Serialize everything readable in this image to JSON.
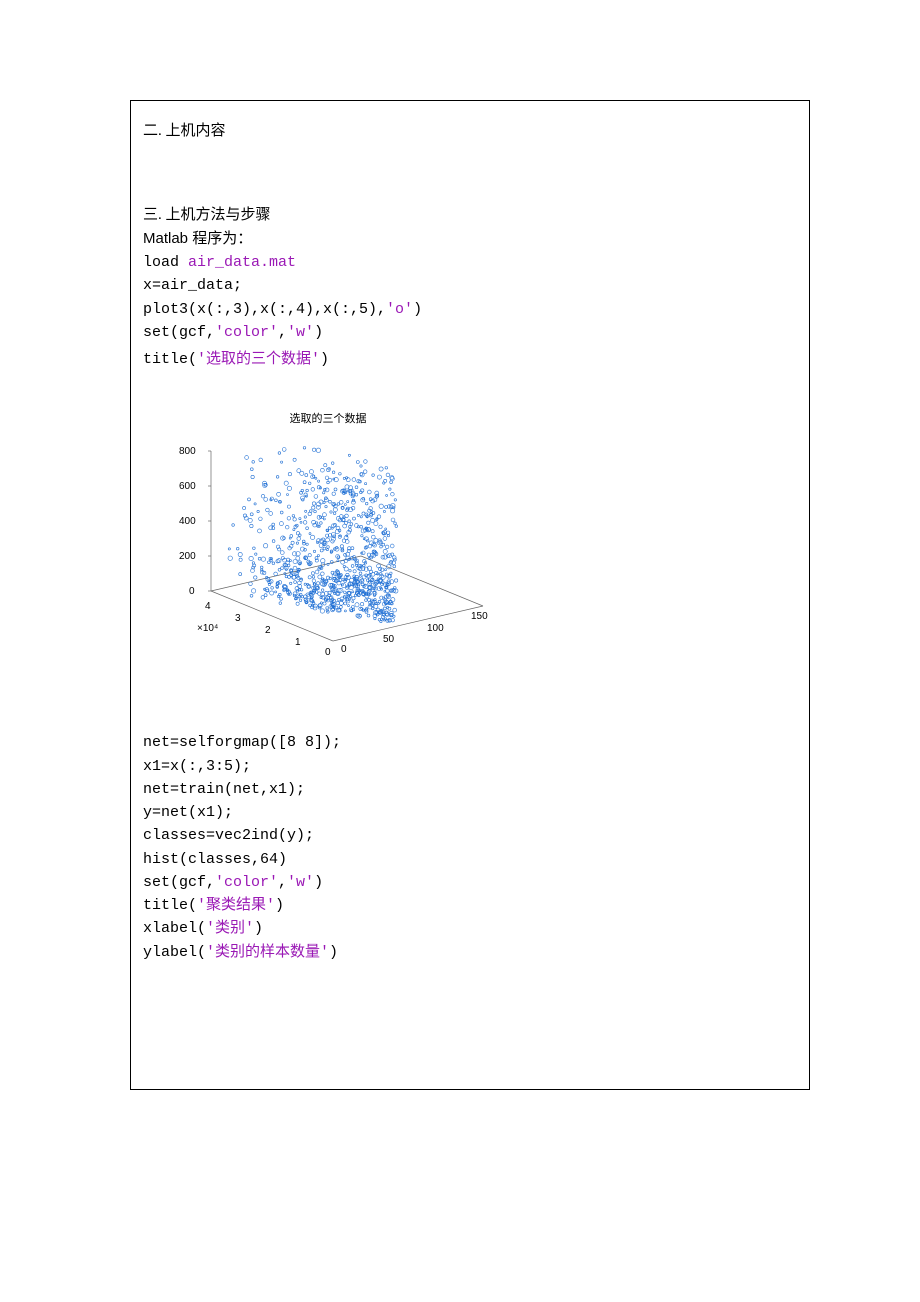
{
  "sections": {
    "s2": "二.   上机内容",
    "s3": "三.   上机方法与步骤",
    "matlab_label": "Matlab 程序为："
  },
  "code1": {
    "l1a": "load ",
    "l1b": "air_data.mat",
    "l2": "x=air_data;",
    "l3a": "plot3(x(:,3),x(:,4),x(:,5),",
    "l3b": "'o'",
    "l3c": ")",
    "l4a": "set(gcf,",
    "l4b": "'color'",
    "l4c": ",",
    "l4d": "'w'",
    "l4e": ")",
    "l5a": "title(",
    "l5b": "'选取的三个数据'",
    "l5c": ")"
  },
  "code2": {
    "l1": "net=selforgmap([8 8]);",
    "l2": "x1=x(:,3:5);",
    "l3": "net=train(net,x1);",
    "l4": "y=net(x1);",
    "l5": "classes=vec2ind(y);",
    "l6": "hist(classes,64)",
    "l7a": "set(gcf,",
    "l7b": "'color'",
    "l7c": ",",
    "l7d": "'w'",
    "l7e": ")",
    "l8a": "title(",
    "l8b": "'聚类结果'",
    "l8c": ")",
    "l9a": "xlabel(",
    "l9b": "'类别'",
    "l9c": ")",
    "l10a": "ylabel(",
    "l10b": "'类别的样本数量'",
    "l10c": ")"
  },
  "chart_data": {
    "type": "scatter",
    "title": "选取的三个数据",
    "z_ticks": [
      0,
      200,
      400,
      600,
      800
    ],
    "x_ticks": [
      0,
      1,
      2,
      3,
      4
    ],
    "x_exp": "×10⁴",
    "y_ticks": [
      0,
      50,
      100,
      150
    ],
    "xlabel": "",
    "ylabel": "",
    "zlabel": "",
    "note": "dense 3D scatter cloud of blue circle markers concentrated near low x/y, z up to ~800"
  },
  "chart": {
    "title": "选取的三个数据",
    "z800": "800",
    "z600": "600",
    "z400": "400",
    "z200": "200",
    "z0": "0",
    "x0": "0",
    "x1": "1",
    "x2": "2",
    "x3": "3",
    "x4": "4",
    "xexp": "×10⁴",
    "y0": "0",
    "y50": "50",
    "y100": "100",
    "y150": "150"
  }
}
